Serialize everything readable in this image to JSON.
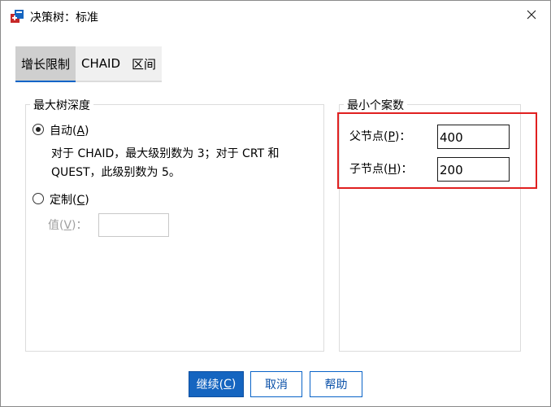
{
  "window": {
    "title": "决策树：标准",
    "app_icon": "spss-tree-icon",
    "close_icon": "close-icon"
  },
  "tabs": [
    {
      "label": "增长限制",
      "active": true
    },
    {
      "label": "CHAID",
      "active": false
    },
    {
      "label": "区间",
      "active": false
    }
  ],
  "max_depth": {
    "legend": "最大树深度",
    "auto": {
      "label_main": "自动(",
      "mnemonic": "A",
      "label_end": ")",
      "selected": true
    },
    "description_line1": "对于 CHAID，最大级别数为 3；对于 CRT 和",
    "description_line2": "QUEST，此级别数为 5。",
    "custom": {
      "label_main": "定制(",
      "mnemonic": "C",
      "label_end": ")",
      "selected": false
    },
    "value": {
      "label_main": "值(",
      "mnemonic": "V",
      "label_end": ")：",
      "value": ""
    }
  },
  "min_cases": {
    "legend": "最小个案数",
    "parent": {
      "label_main": "父节点(",
      "mnemonic": "P",
      "label_end": ")：",
      "value": "400"
    },
    "child": {
      "label_main": "子节点(",
      "mnemonic": "H",
      "label_end": ")：",
      "value": "200"
    }
  },
  "buttons": {
    "continue": {
      "label_main": "继续(",
      "mnemonic": "C",
      "label_end": ")"
    },
    "cancel": "取消",
    "help": "帮助"
  },
  "colors": {
    "accent": "#1565c0",
    "highlight": "#e02020"
  }
}
